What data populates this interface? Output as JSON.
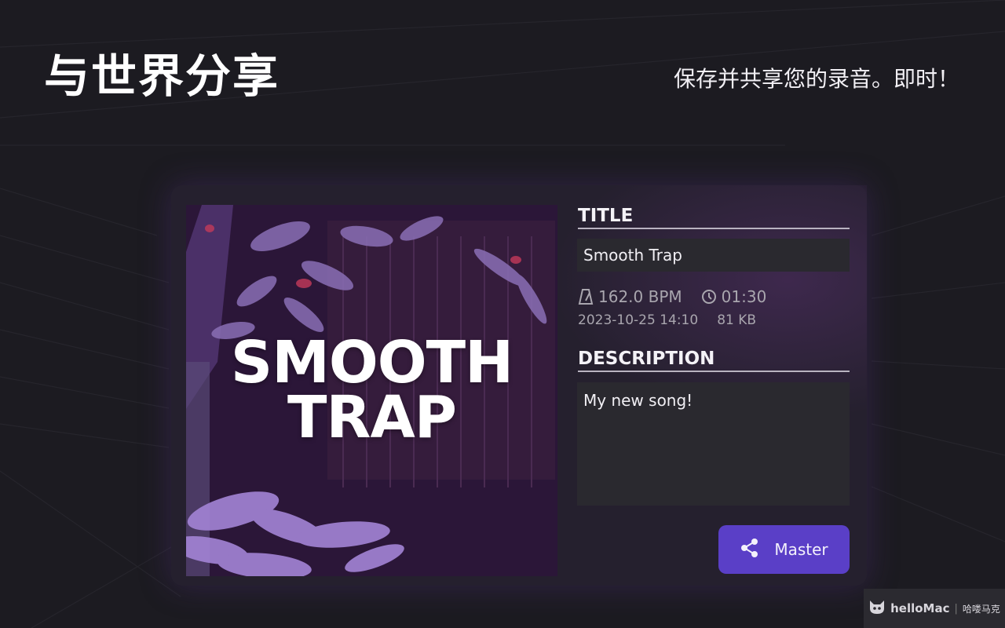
{
  "header": {
    "headline": "与世界分享",
    "tagline": "保存并共享您的录音。即时！"
  },
  "card": {
    "cover": {
      "title_line1": "SMOOTH",
      "title_line2": "TRAP"
    },
    "title_section": {
      "label": "TITLE",
      "value": "Smooth Trap"
    },
    "meta": {
      "bpm": "162.0 BPM",
      "duration": "01:30",
      "date": "2023-10-25 14:10",
      "size": "81 KB",
      "icons": [
        "metronome-icon",
        "clock-icon"
      ]
    },
    "description_section": {
      "label": "DESCRIPTION",
      "value": "My new song!"
    },
    "action_button": {
      "label": "Master",
      "icon": "share-icon"
    }
  },
  "watermark": {
    "brand": "helloMac",
    "separator": "|",
    "cn": "哈喽马克"
  },
  "colors": {
    "background": "#1c1b21",
    "card": "#25202e",
    "field": "#2a292f",
    "accent": "#5a3fc7",
    "text_muted": "#a9a6ae"
  }
}
